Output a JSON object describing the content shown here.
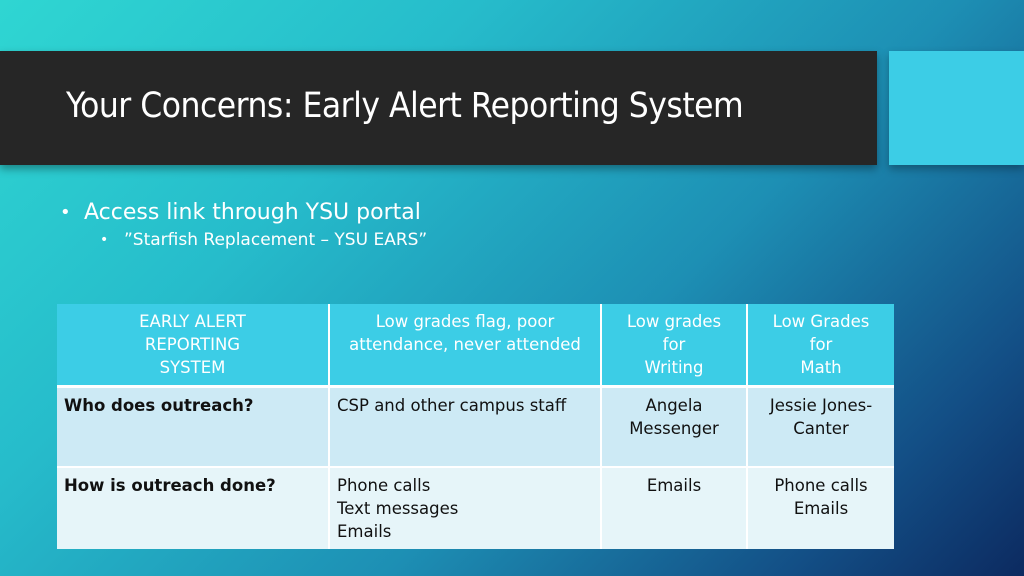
{
  "slide": {
    "title": "Your Concerns: Early Alert Reporting System",
    "bullets": [
      {
        "text": "Access link through YSU portal",
        "sub": [
          "”Starfish Replacement – YSU EARS”"
        ]
      }
    ],
    "colors": {
      "title_bar": "#262626",
      "accent": "#3ccde6",
      "header_row": "#3ccde6",
      "row_1": "#cdeaf5",
      "row_2": "#e6f5f9"
    }
  },
  "table": {
    "headers": [
      [
        "EARLY ALERT",
        "REPORTING",
        "SYSTEM"
      ],
      [
        "Low grades flag, poor",
        "attendance, never attended"
      ],
      [
        "Low grades",
        "for",
        "Writing"
      ],
      [
        "Low Grades",
        "for",
        "Math"
      ]
    ],
    "rows": [
      {
        "label": "Who does outreach?",
        "cells": [
          [
            "CSP and other campus staff"
          ],
          [
            "Angela",
            "Messenger"
          ],
          [
            "Jessie Jones-",
            "Canter"
          ]
        ]
      },
      {
        "label": "How is outreach done?",
        "cells": [
          [
            "Phone calls",
            "Text messages",
            "Emails"
          ],
          [
            "Emails"
          ],
          [
            "Phone calls",
            "Emails"
          ]
        ]
      }
    ]
  }
}
